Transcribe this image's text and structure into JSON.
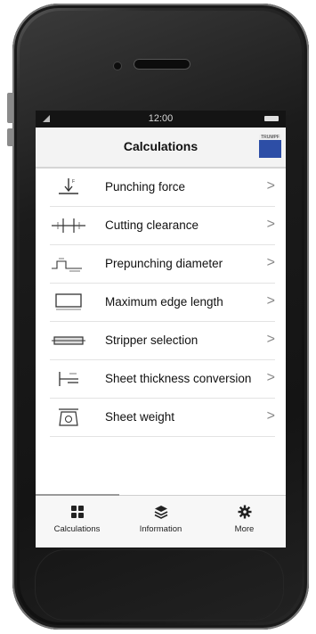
{
  "status": {
    "time": "12:00"
  },
  "header": {
    "title": "Calculations",
    "logo_text": "TRUMPF"
  },
  "list": [
    {
      "label": "Punching force",
      "icon": "punching-force-icon"
    },
    {
      "label": "Cutting clearance",
      "icon": "cutting-clearance-icon"
    },
    {
      "label": "Prepunching diameter",
      "icon": "prepunching-diameter-icon"
    },
    {
      "label": "Maximum edge length",
      "icon": "edge-length-icon"
    },
    {
      "label": "Stripper selection",
      "icon": "stripper-icon"
    },
    {
      "label": "Sheet thickness conversion",
      "icon": "sheet-thickness-icon"
    },
    {
      "label": "Sheet weight",
      "icon": "scale-icon"
    }
  ],
  "chevron": ">",
  "tabs": [
    {
      "label": "Calculations",
      "icon": "grid-icon",
      "active": true
    },
    {
      "label": "Information",
      "icon": "layers-icon",
      "active": false
    },
    {
      "label": "More",
      "icon": "gear-icon",
      "active": false
    }
  ]
}
